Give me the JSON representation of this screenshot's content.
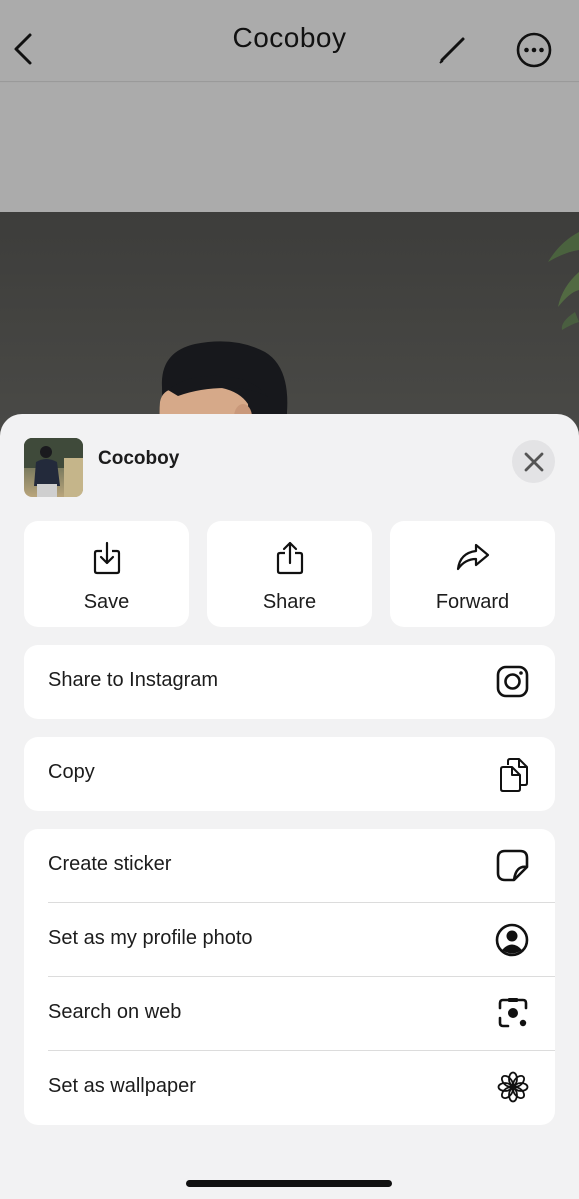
{
  "topbar": {
    "title": "Cocoboy",
    "back_icon": "chevron-left-icon",
    "edit_icon": "pencil-icon",
    "more_icon": "ellipsis-circle-icon"
  },
  "sheet": {
    "title": "Cocoboy",
    "close_icon": "close-icon",
    "actions": [
      {
        "label": "Save",
        "icon": "download-tray-icon"
      },
      {
        "label": "Share",
        "icon": "share-icon"
      },
      {
        "label": "Forward",
        "icon": "forward-arrow-icon"
      }
    ],
    "share_instagram": {
      "label": "Share to Instagram",
      "icon": "instagram-icon"
    },
    "copy": {
      "label": "Copy",
      "icon": "copy-icon"
    },
    "options": [
      {
        "label": "Create sticker",
        "icon": "sticker-icon"
      },
      {
        "label": "Set as my profile photo",
        "icon": "profile-circle-icon"
      },
      {
        "label": "Search on web",
        "icon": "visual-search-icon"
      },
      {
        "label": "Set as wallpaper",
        "icon": "wallpaper-flower-icon"
      }
    ]
  },
  "colors": {
    "sheet_bg": "#f2f2f3",
    "card_bg": "#ffffff",
    "dim_bg": "#ababab",
    "text": "#1c1c1c"
  }
}
